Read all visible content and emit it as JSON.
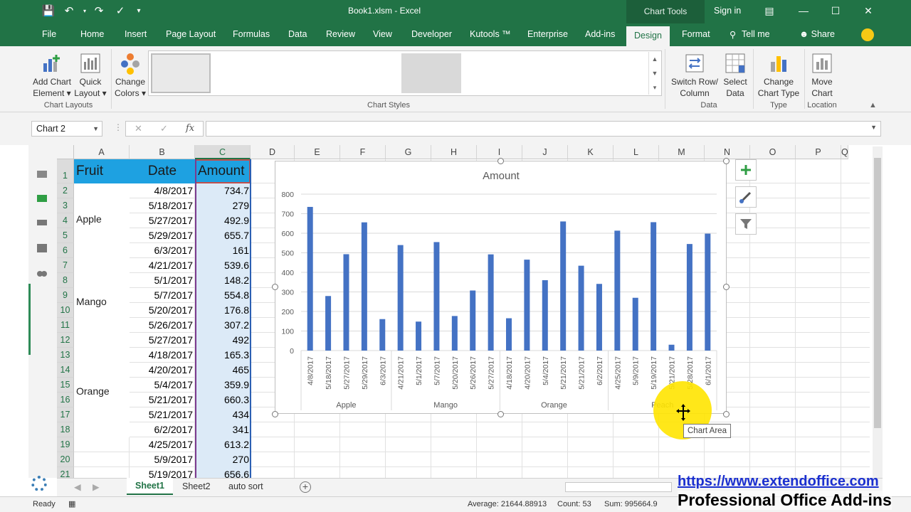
{
  "window": {
    "title": "Book1.xlsm  -  Excel",
    "context_tab": "Chart Tools",
    "sign_in": "Sign in"
  },
  "ribbon_tabs": [
    "File",
    "Home",
    "Insert",
    "Page Layout",
    "Formulas",
    "Data",
    "Review",
    "View",
    "Developer",
    "Kutools ™",
    "Enterprise",
    "Add-ins",
    "Design",
    "Format",
    "Tell me",
    "Share"
  ],
  "ribbon": {
    "add_chart_element": [
      "Add Chart",
      "Element ▾"
    ],
    "quick_layout": [
      "Quick",
      "Layout ▾"
    ],
    "change_colors": [
      "Change",
      "Colors ▾"
    ],
    "switch_row_col": [
      "Switch Row/",
      "Column"
    ],
    "select_data": [
      "Select",
      "Data"
    ],
    "change_chart_type": [
      "Change",
      "Chart Type"
    ],
    "move_chart": [
      "Move",
      "Chart"
    ],
    "groups": {
      "chart_layouts": "Chart Layouts",
      "chart_styles": "Chart Styles",
      "data": "Data",
      "type": "Type",
      "location": "Location"
    }
  },
  "formula_bar": {
    "name_box": "Chart 2",
    "fx": "fx",
    "value": ""
  },
  "columns": [
    "A",
    "B",
    "C",
    "D",
    "E",
    "F",
    "G",
    "H",
    "I",
    "J",
    "K",
    "L",
    "M",
    "N",
    "O",
    "P",
    "Q"
  ],
  "rows": [
    "1",
    "2",
    "3",
    "4",
    "5",
    "6",
    "7",
    "8",
    "9",
    "10",
    "11",
    "12",
    "13",
    "14",
    "15",
    "16",
    "17",
    "18",
    "19",
    "20",
    "21"
  ],
  "sheet": {
    "headers": [
      "Fruit",
      "Date",
      "Amount"
    ],
    "fruits": [
      "Apple",
      "Mango",
      "Orange"
    ],
    "dates": [
      "4/8/2017",
      "5/18/2017",
      "5/27/2017",
      "5/29/2017",
      "6/3/2017",
      "4/21/2017",
      "5/1/2017",
      "5/7/2017",
      "5/20/2017",
      "5/26/2017",
      "5/27/2017",
      "4/18/2017",
      "4/20/2017",
      "5/4/2017",
      "5/21/2017",
      "5/21/2017",
      "6/2/2017",
      "4/25/2017",
      "5/9/2017",
      "5/19/2017"
    ],
    "amounts": [
      "734.7",
      "279",
      "492.9",
      "655.7",
      "161",
      "539.6",
      "148.2",
      "554.8",
      "176.8",
      "307.2",
      "492",
      "165.3",
      "465",
      "359.9",
      "660.3",
      "434",
      "341",
      "613.2",
      "270",
      "656.6"
    ]
  },
  "chart_data": {
    "type": "bar",
    "title": "Amount",
    "ylim": [
      0,
      800
    ],
    "yticks": [
      "0",
      "100",
      "200",
      "300",
      "400",
      "500",
      "600",
      "700",
      "800"
    ],
    "categories": [
      "4/8/2017",
      "5/18/2017",
      "5/27/2017",
      "5/29/2017",
      "6/3/2017",
      "4/21/2017",
      "5/1/2017",
      "5/7/2017",
      "5/20/2017",
      "5/26/2017",
      "5/27/2017",
      "4/18/2017",
      "4/20/2017",
      "5/4/2017",
      "5/21/2017",
      "5/21/2017",
      "6/2/2017",
      "4/25/2017",
      "5/9/2017",
      "5/19/2017",
      "5/21/2017",
      "5/28/2017",
      "6/1/2017"
    ],
    "groups": [
      {
        "name": "Apple",
        "count": 5
      },
      {
        "name": "Mango",
        "count": 6
      },
      {
        "name": "Orange",
        "count": 6
      },
      {
        "name": "Peach",
        "count": 6
      }
    ],
    "values": [
      734.7,
      279,
      492.9,
      655.7,
      161,
      539.6,
      148.2,
      554.8,
      176.8,
      307.2,
      492,
      165.3,
      465,
      359.9,
      660.3,
      434,
      341,
      613.2,
      270,
      656.6,
      30,
      545,
      598
    ],
    "bar_color": "#4472c4",
    "grid": true,
    "legend": "none"
  },
  "tooltip": "Chart Area",
  "sheet_tabs": [
    "Sheet1",
    "Sheet2",
    "auto sort"
  ],
  "status": {
    "ready": "Ready",
    "average": "Average: 21644.88913",
    "count": "Count: 53",
    "sum": "Sum: 995664.9"
  },
  "watermark": {
    "url": "https://www.extendoffice.com",
    "tagline": "Professional Office Add-ins"
  },
  "colors": {
    "excel_green": "#217346",
    "header_fill": "#1ea1e1",
    "bar": "#4472c4"
  }
}
